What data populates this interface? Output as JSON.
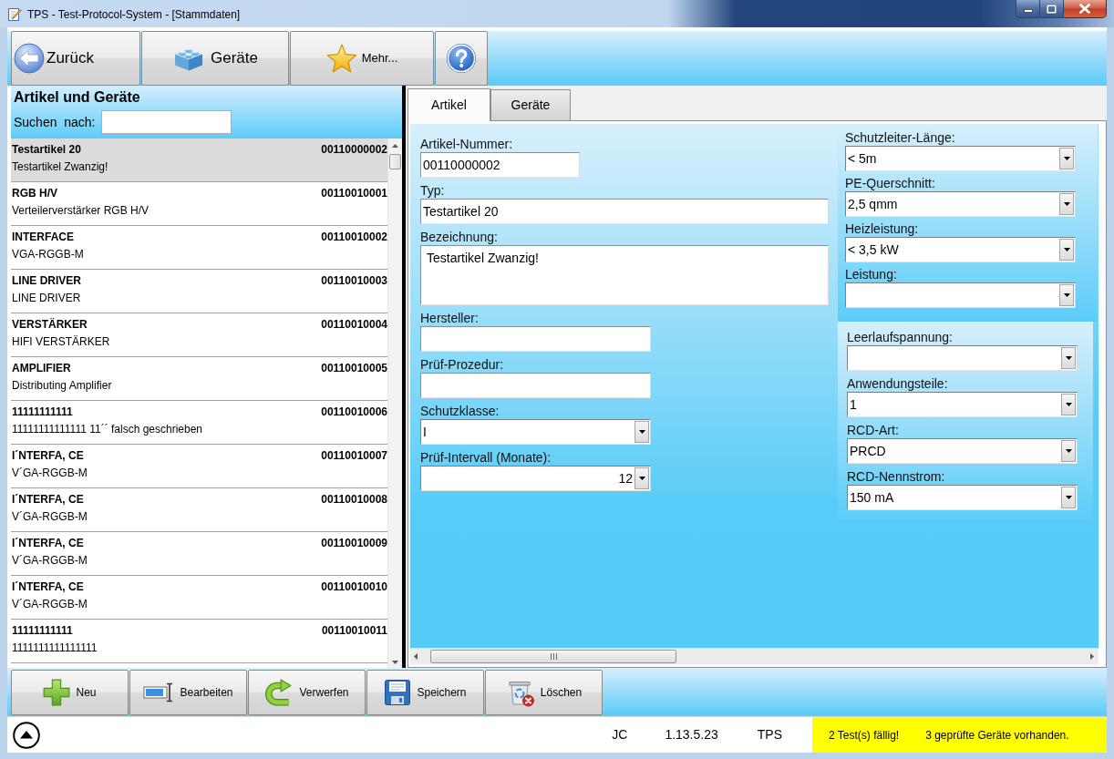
{
  "window": {
    "title": "TPS - Test-Protocol-System - [Stammdaten]"
  },
  "toolbar": [
    {
      "kind": "back",
      "label": "Zurück"
    },
    {
      "kind": "devices",
      "label": "Geräte"
    },
    {
      "kind": "more",
      "label": "Mehr..."
    },
    {
      "kind": "help"
    }
  ],
  "list": {
    "title": "Artikel und Geräte",
    "search_label": "Suchen  nach:",
    "items": [
      {
        "name": "Testartikel 20",
        "number": "00110000002",
        "description": "Testartikel Zwanzig!",
        "selected": true
      },
      {
        "name": "RGB H/V",
        "number": "00110010001",
        "description": "Verteilerverstärker RGB H/V",
        "selected": false
      },
      {
        "name": "INTERFACE",
        "number": "00110010002",
        "description": "VGA-RGGB-M",
        "selected": false
      },
      {
        "name": "LINE DRIVER",
        "number": "00110010003",
        "description": "LINE DRIVER",
        "selected": false
      },
      {
        "name": "VERSTÄRKER",
        "number": "00110010004",
        "description": "HIFI VERSTÄRKER",
        "selected": false
      },
      {
        "name": "AMPLIFIER",
        "number": "00110010005",
        "description": "Distributing Amplifier",
        "selected": false
      },
      {
        "name": "11111111111",
        "number": "00110010006",
        "description": "11111111111111 11´´ falsch geschrieben",
        "selected": false
      },
      {
        "name": "I´NTERFA, CE",
        "number": "00110010007",
        "description": "V´GA-RGGB-M",
        "selected": false
      },
      {
        "name": "I´NTERFA, CE",
        "number": "00110010008",
        "description": "V´GA-RGGB-M",
        "selected": false
      },
      {
        "name": "I´NTERFA, CE",
        "number": "00110010009",
        "description": "V´GA-RGGB-M",
        "selected": false
      },
      {
        "name": "I´NTERFA, CE",
        "number": "00110010010",
        "description": "V´GA-RGGB-M",
        "selected": false
      },
      {
        "name": "11111111111",
        "number": "00110010011",
        "description": "1111111111111111",
        "selected": false
      }
    ]
  },
  "tabs": [
    {
      "label": "Artikel",
      "selected": true
    },
    {
      "label": "Geräte",
      "selected": false
    }
  ],
  "form": {
    "fields": [
      {
        "kind": "code",
        "label": "Artikel-Nummer:",
        "value": "00110000002"
      },
      {
        "kind": "line",
        "label": "Typ:",
        "value": "Testartikel 20"
      },
      {
        "kind": "memo",
        "label": "Bezeichnung:",
        "value": "Testartikel Zwanzig!"
      },
      {
        "kind": "text",
        "label": "Hersteller:"
      },
      {
        "kind": "text",
        "label": "Prüf-Prozedur:"
      },
      {
        "kind": "choice",
        "label": "Schutzklasse:",
        "value": "I"
      },
      {
        "kind": "count",
        "label": "Prüf-Intervall (Monate):",
        "value": "12"
      }
    ],
    "groups": [
      {
        "fields": [
          {
            "label": "Schutzleiter-Länge:",
            "value": "< 5m"
          },
          {
            "label": "PE-Querschnitt:",
            "value": "2,5 qmm"
          },
          {
            "label": "Heizleistung:",
            "value": "< 3,5 kW"
          },
          {
            "label": "Leistung:"
          }
        ]
      },
      {
        "fields": [
          {
            "label": "Leerlaufspannung:"
          },
          {
            "label": "Anwendungsteile:",
            "value": "1"
          },
          {
            "label": "RCD-Art:",
            "value": "PRCD"
          },
          {
            "label": "RCD-Nennstrom:",
            "value": "150 mA"
          }
        ]
      }
    ]
  },
  "actions": [
    {
      "kind": "new",
      "label": "Neu"
    },
    {
      "kind": "edit",
      "label": "Bearbeiten"
    },
    {
      "kind": "discard",
      "label": "Verwerfen"
    },
    {
      "kind": "save",
      "label": "Speichern"
    },
    {
      "kind": "delete",
      "label": "Löschen"
    }
  ],
  "status_bar": {
    "user": "JC",
    "version": "1.13.5.23",
    "app": "TPS",
    "alerts": [
      "2 Test(s) fällig!",
      "3 geprüfte Geräte vorhanden."
    ]
  }
}
